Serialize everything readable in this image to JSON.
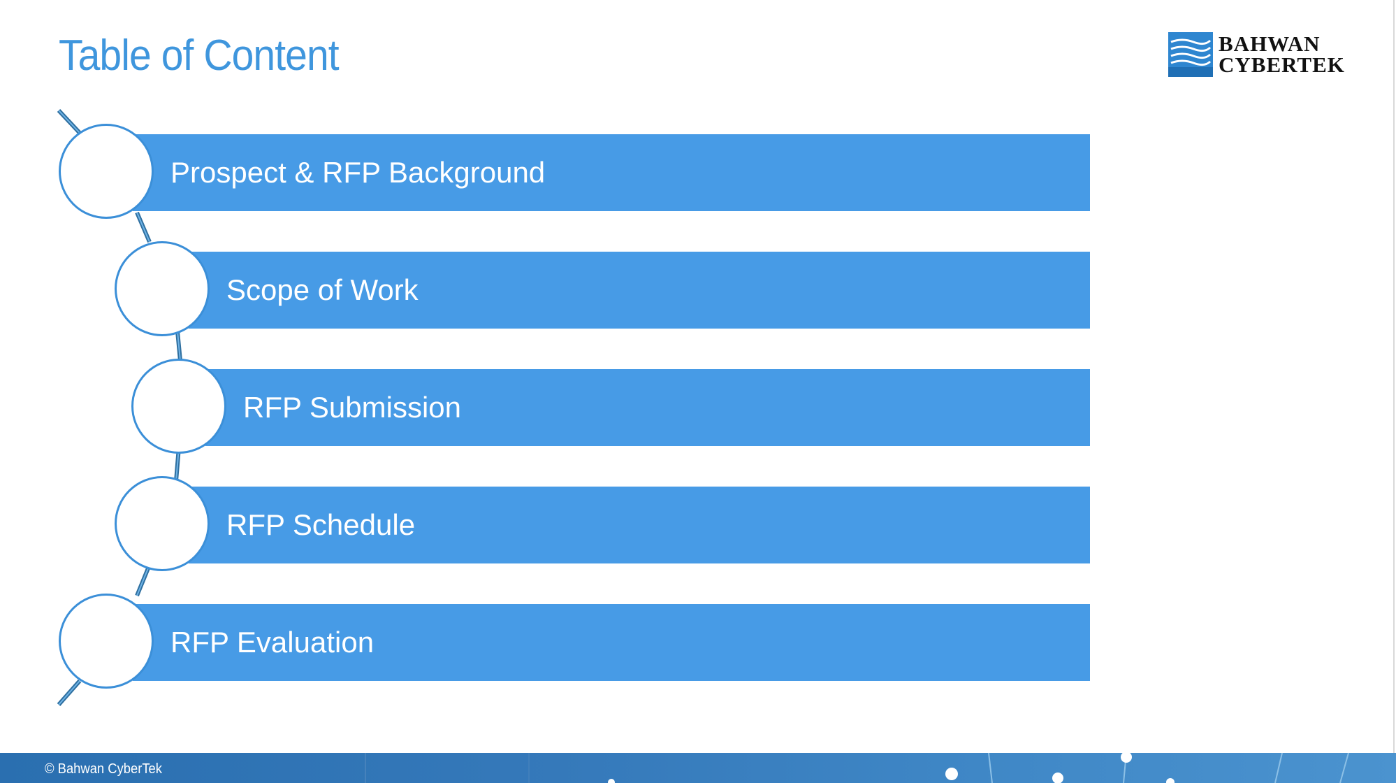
{
  "slide": {
    "title": "Table of Content",
    "logo": {
      "line1": "BAHWAN",
      "line2": "CYBERTEK",
      "icon": "bahwan-cybertek-logo-icon"
    },
    "items": [
      {
        "label": "Prospect & RFP Background"
      },
      {
        "label": "Scope of Work"
      },
      {
        "label": "RFP Submission"
      },
      {
        "label": "RFP Schedule"
      },
      {
        "label": "RFP Evaluation"
      }
    ],
    "footer": {
      "copyright": "© Bahwan CyberTek"
    }
  },
  "colors": {
    "title": "#3f96dd",
    "bar": "#479be6",
    "circle_border": "#3b8fd8",
    "footer": "#2f73b3"
  }
}
